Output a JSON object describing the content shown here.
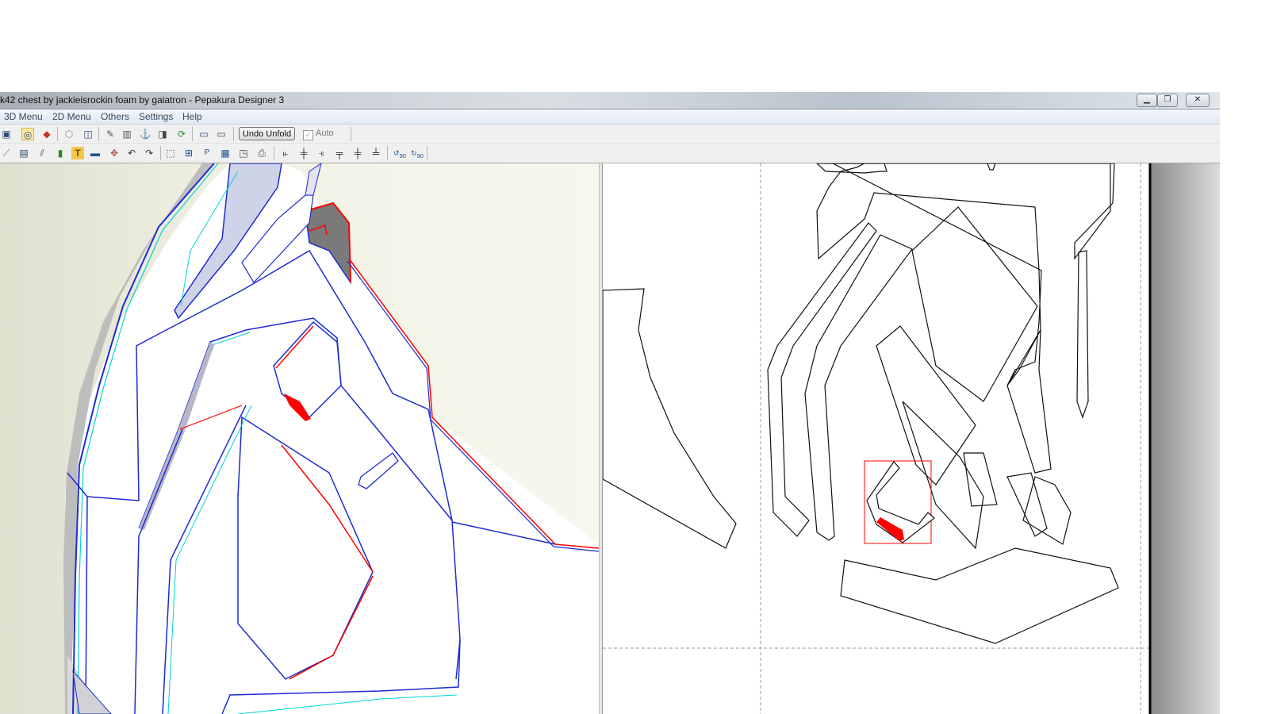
{
  "window": {
    "title": "k42 chest by jackieisrockin foam by gaiatron - Pepakura Designer 3",
    "controls": [
      "minimize",
      "restore",
      "close"
    ]
  },
  "menu": [
    "3D Menu",
    "2D Menu",
    "Others",
    "Settings",
    "Help"
  ],
  "toolbar1": {
    "icons": [
      "save-icon",
      "lightbulb-icon",
      "cube-color-icon",
      "cube-outline-icon",
      "box-icon",
      "pencil-icon",
      "columns-icon",
      "anchor-icon",
      "split-icon",
      "rotate-box-icon",
      "single-view-icon",
      "dual-view-icon"
    ],
    "undo_label": "Undo Unfold",
    "auto_label": "Auto",
    "auto_checked": true
  },
  "toolbar2": {
    "icons": [
      "edge-icon",
      "ruler-icon",
      "brush-icon",
      "glue-icon",
      "text-icon",
      "image-icon",
      "move-icon",
      "undo-icon",
      "redo-icon",
      "select-icon",
      "join-icon",
      "page-icon",
      "layout-icon",
      "print-preview-icon",
      "print-icon",
      "align-left-icon",
      "align-center-icon",
      "align-right-icon",
      "align-top-icon",
      "align-middle-icon",
      "align-bottom-icon"
    ],
    "rotate_ccw_label": "90",
    "rotate_cw_label": "90"
  },
  "colors": {
    "accent_red": "#ff0000",
    "edge_blue": "#1d2bd1",
    "edge_cyan": "#00d5d5",
    "panel_bg": "#f0f0f0"
  }
}
